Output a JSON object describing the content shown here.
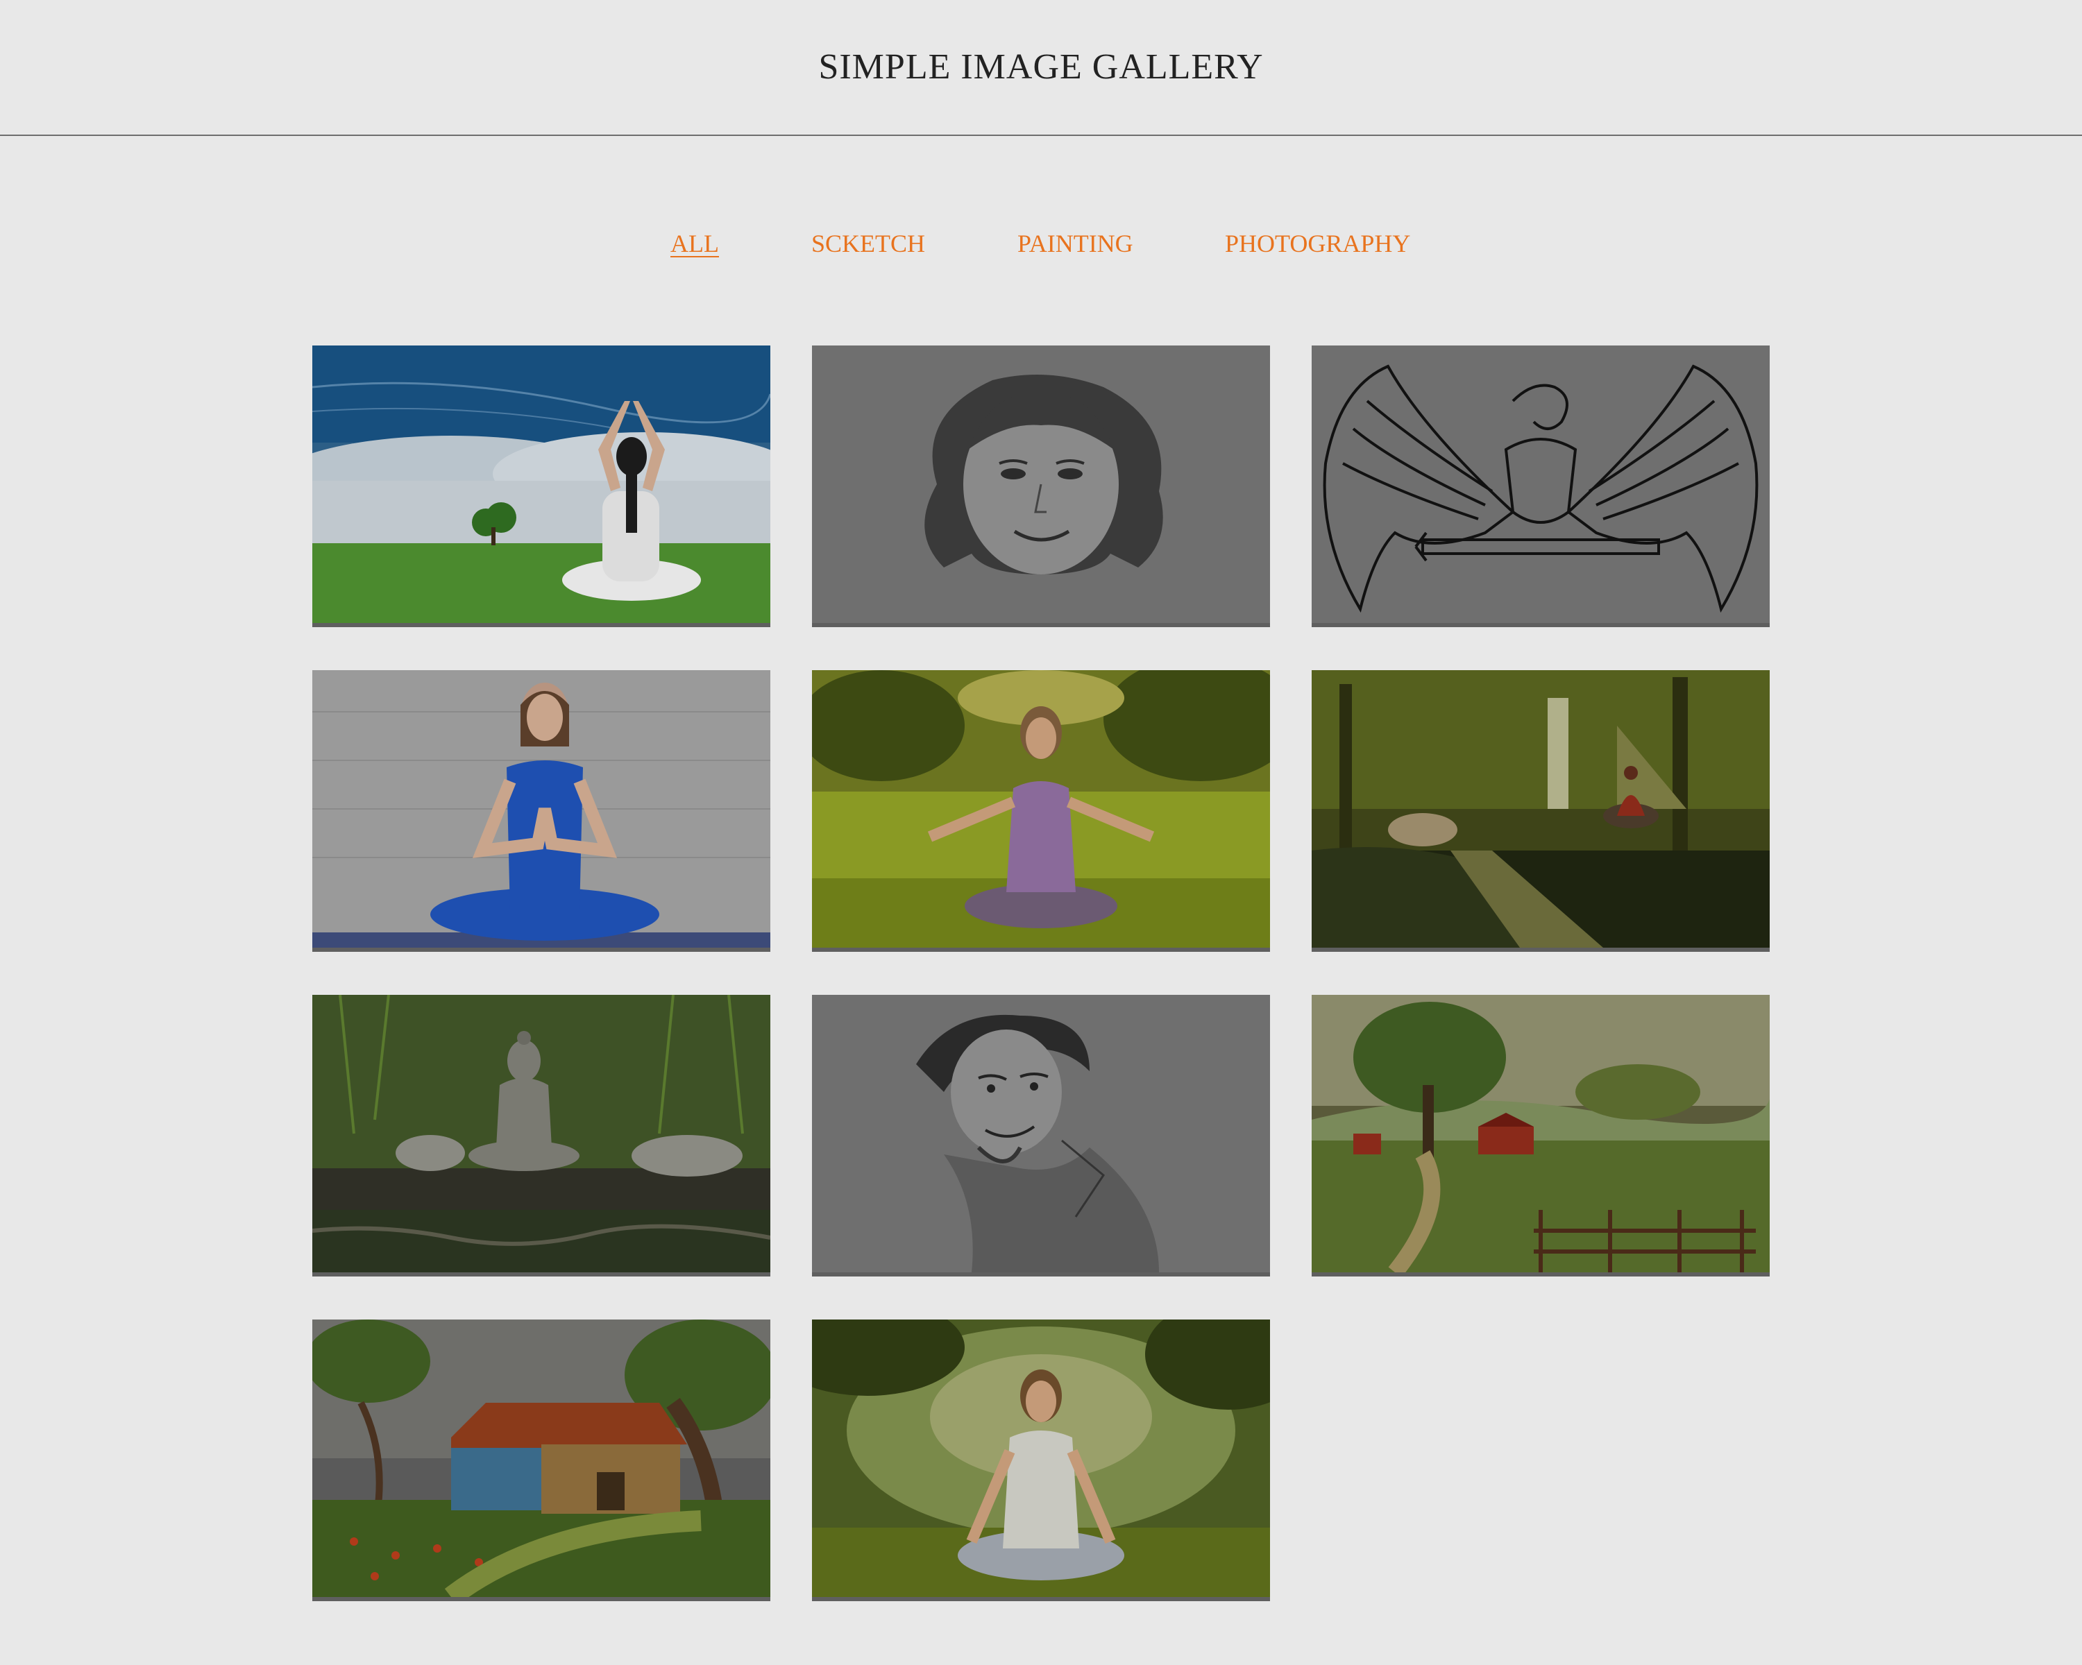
{
  "header": {
    "title": "SIMPLE IMAGE GALLERY"
  },
  "filters": [
    {
      "label": "ALL",
      "active": true
    },
    {
      "label": "SCKETCH",
      "active": false
    },
    {
      "label": "PAINTING",
      "active": false
    },
    {
      "label": "PHOTOGRAPHY",
      "active": false
    }
  ],
  "gallery": [
    {
      "subject": "yoga-sky",
      "category": "photography"
    },
    {
      "subject": "woman-portrait-sketch",
      "category": "sketch"
    },
    {
      "subject": "eagle-sketch",
      "category": "sketch"
    },
    {
      "subject": "yoga-blue",
      "category": "photography"
    },
    {
      "subject": "meditation-field",
      "category": "photography"
    },
    {
      "subject": "monk-forest-painting",
      "category": "painting"
    },
    {
      "subject": "buddha-stones",
      "category": "photography"
    },
    {
      "subject": "boy-portrait-sketch",
      "category": "sketch"
    },
    {
      "subject": "farm-landscape-painting",
      "category": "painting"
    },
    {
      "subject": "barn-painting",
      "category": "painting"
    },
    {
      "subject": "meditation-sunlight",
      "category": "photography"
    }
  ],
  "colors": {
    "accent": "#e8731e",
    "background": "#e8e8e8",
    "overlay": "#6f6f6f"
  }
}
